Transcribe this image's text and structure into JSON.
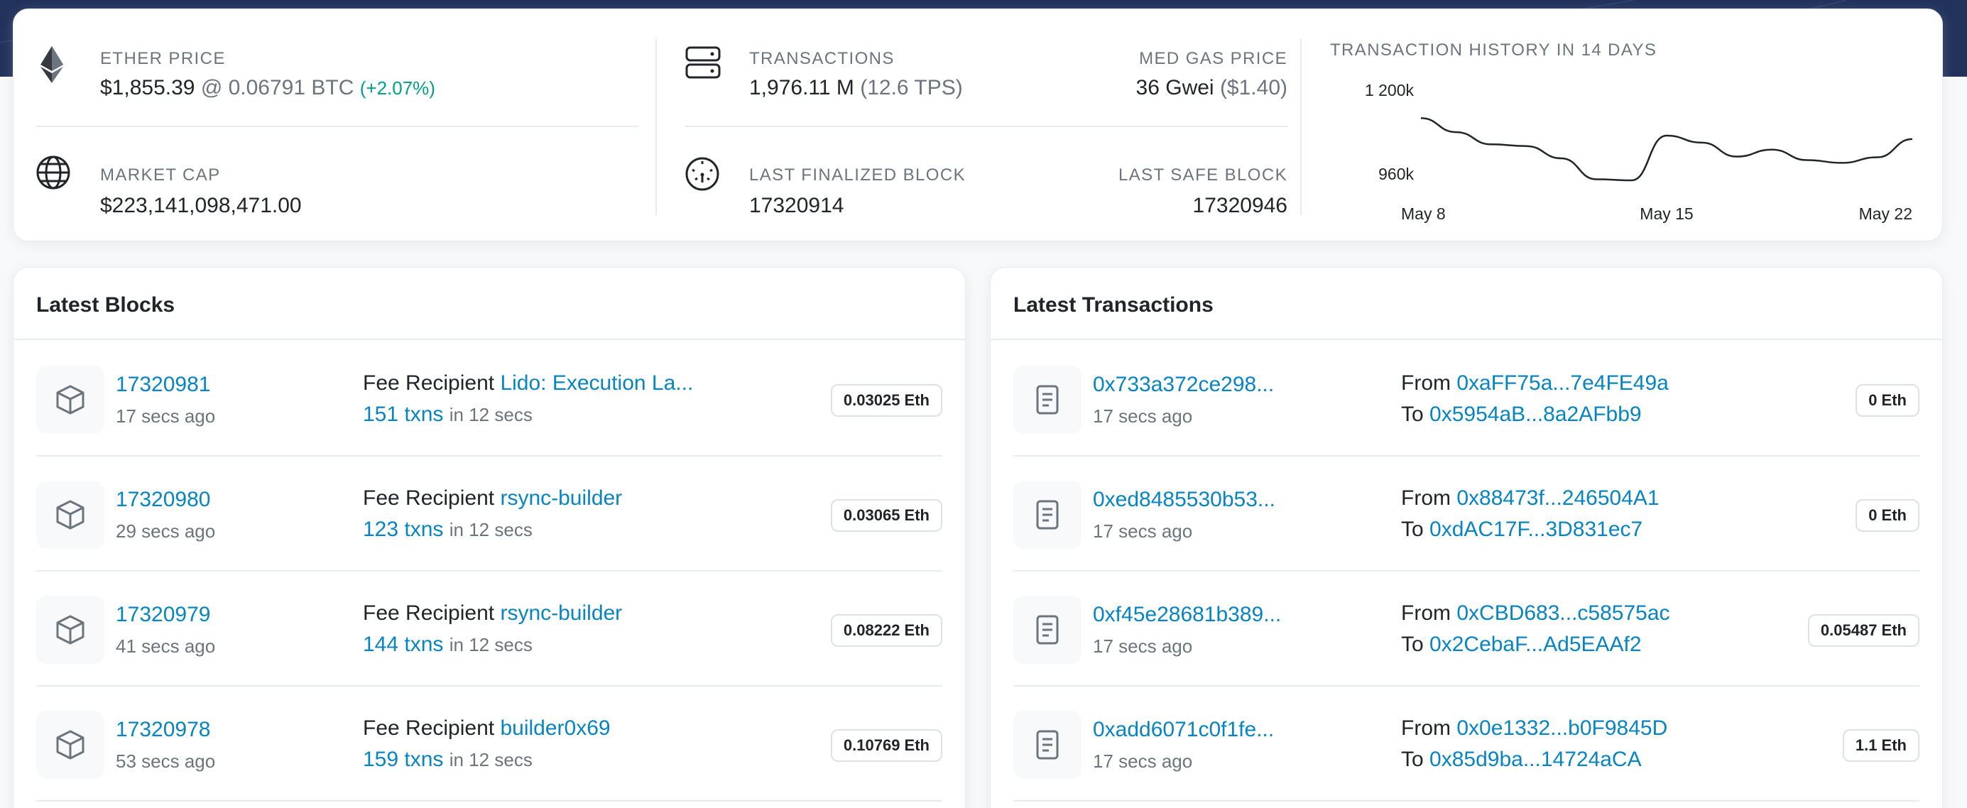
{
  "stats": {
    "ether_price": {
      "label": "ETHER PRICE",
      "usd": "$1,855.39",
      "at": "@ 0.06791 BTC",
      "change": "(+2.07%)"
    },
    "market_cap": {
      "label": "MARKET CAP",
      "value": "$223,141,098,471.00"
    },
    "transactions": {
      "label": "TRANSACTIONS",
      "value": "1,976.11 M",
      "tps": "(12.6 TPS)"
    },
    "med_gas": {
      "label": "MED GAS PRICE",
      "value": "36 Gwei",
      "usd": "($1.40)"
    },
    "last_finalized": {
      "label": "LAST FINALIZED BLOCK",
      "value": "17320914"
    },
    "last_safe": {
      "label": "LAST SAFE BLOCK",
      "value": "17320946"
    }
  },
  "chart_data": {
    "type": "line",
    "title": "TRANSACTION HISTORY IN 14 DAYS",
    "x": [
      "May 8",
      "May 9",
      "May 10",
      "May 11",
      "May 12",
      "May 13",
      "May 14",
      "May 15",
      "May 16",
      "May 17",
      "May 18",
      "May 19",
      "May 20",
      "May 21",
      "May 22"
    ],
    "series": [
      {
        "values": [
          1120000,
          1080000,
          1045000,
          1040000,
          1005000,
          945000,
          942000,
          1070000,
          1050000,
          1010000,
          1030000,
          1000000,
          992000,
          1008000,
          1060000
        ]
      }
    ],
    "yticks": [
      "1 200k",
      "960k"
    ],
    "ytick_values": [
      1200000,
      960000
    ],
    "xticks": [
      "May 8",
      "May 15",
      "May 22"
    ],
    "ylim": [
      940000,
      1200000
    ],
    "grid": false,
    "color": "#212529"
  },
  "blocks": {
    "title": "Latest Blocks",
    "fee_label": "Fee Recipient",
    "in_label": "in 12 secs",
    "items": [
      {
        "number": "17320981",
        "ago": "17 secs ago",
        "recipient": "Lido: Execution La...",
        "txns": "151 txns",
        "reward": "0.03025 Eth"
      },
      {
        "number": "17320980",
        "ago": "29 secs ago",
        "recipient": "rsync-builder",
        "txns": "123 txns",
        "reward": "0.03065 Eth"
      },
      {
        "number": "17320979",
        "ago": "41 secs ago",
        "recipient": "rsync-builder",
        "txns": "144 txns",
        "reward": "0.08222 Eth"
      },
      {
        "number": "17320978",
        "ago": "53 secs ago",
        "recipient": "builder0x69",
        "txns": "159 txns",
        "reward": "0.10769 Eth"
      }
    ]
  },
  "transactions": {
    "title": "Latest Transactions",
    "from_label": "From",
    "to_label": "To",
    "items": [
      {
        "hash": "0x733a372ce298...",
        "ago": "17 secs ago",
        "from": "0xaFF75a...7e4FE49a",
        "to": "0x5954aB...8a2AFbb9",
        "value": "0 Eth"
      },
      {
        "hash": "0xed8485530b53...",
        "ago": "17 secs ago",
        "from": "0x88473f...246504A1",
        "to": "0xdAC17F...3D831ec7",
        "value": "0 Eth"
      },
      {
        "hash": "0xf45e28681b389...",
        "ago": "17 secs ago",
        "from": "0xCBD683...c58575ac",
        "to": "0x2CebaF...Ad5EAAf2",
        "value": "0.05487 Eth"
      },
      {
        "hash": "0xadd6071c0f1fe...",
        "ago": "17 secs ago",
        "from": "0x0e1332...b0F9845D",
        "to": "0x85d9ba...14724aCA",
        "value": "1.1 Eth"
      }
    ]
  },
  "icons": {
    "ether": "ethereum-icon",
    "market_cap": "globe-icon",
    "transactions": "server-icon",
    "finalized": "gauge-icon",
    "block": "cube-icon",
    "tx": "document-icon"
  },
  "colors": {
    "link": "#0784c3",
    "positive": "#00a186",
    "hero": "#21325b"
  }
}
